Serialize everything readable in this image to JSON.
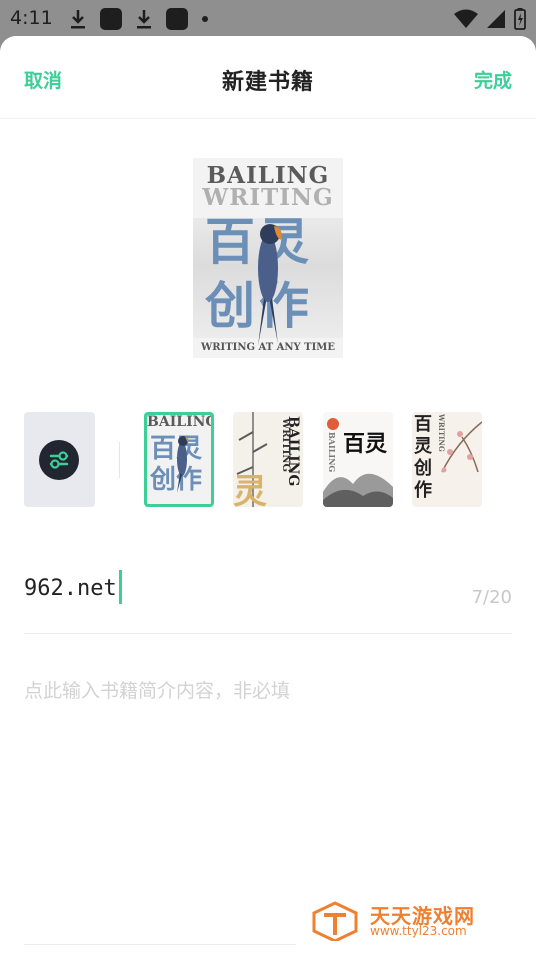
{
  "status_bar": {
    "time": "4:11",
    "icons_left": [
      "download-icon",
      "app-square-icon",
      "download-icon",
      "app-square-icon",
      "dot-icon"
    ],
    "icons_right": [
      "wifi-icon",
      "signal-icon",
      "battery-icon"
    ]
  },
  "header": {
    "cancel_label": "取消",
    "title": "新建书籍",
    "done_label": "完成"
  },
  "cover_preview": {
    "en_title": "BAILING",
    "en_title_2": "WRITING",
    "cn_line_1": "百灵",
    "cn_line_2": "创作",
    "bottom_text": "WRITING AT ANY TIME"
  },
  "cover_options": {
    "custom_button_icon": "settings-sliders-icon",
    "thumbs": [
      {
        "en": "BAILING",
        "cn_1": "百灵",
        "cn_2": "创作",
        "selected": true
      },
      {
        "en": "BAILING",
        "en_2": "WRITING",
        "cn_1": "灵",
        "selected": false
      },
      {
        "en": "BAILING",
        "cn_1": "百灵",
        "selected": false
      },
      {
        "en": "WRITING",
        "cn_1": "百",
        "cn_2": "灵",
        "cn_3": "创",
        "cn_4": "作",
        "selected": false
      }
    ]
  },
  "book_name": {
    "value": "962.net",
    "counter": "7/20"
  },
  "intro": {
    "placeholder": "点此输入书籍简介内容，非必填"
  },
  "watermark": {
    "cn": "天天游戏网",
    "url": "www.ttyl23.com"
  },
  "colors": {
    "accent": "#3ccf97",
    "watermark": "#f0802f"
  }
}
